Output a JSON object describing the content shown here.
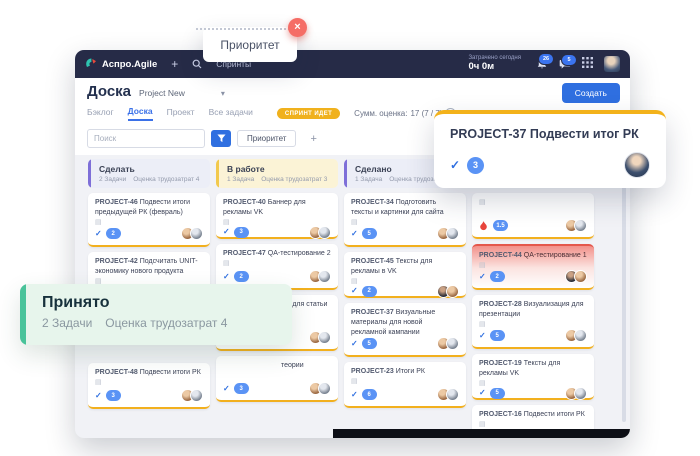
{
  "tooltip": {
    "label": "Приоритет"
  },
  "accepted_overlay": {
    "title": "Принято",
    "tasks": "2 Задачи",
    "effort": "Оценка трудозатрат 4"
  },
  "focus_card": {
    "title": "PROJECT-37 Подвести итог РК",
    "score": "3"
  },
  "navbar": {
    "brand": "Аспро.Agile",
    "nav_item": "Спринты",
    "time_label": "Затрачено сегодня",
    "time_value": "0ч 0м",
    "bell_badge": "26",
    "chat_badge": "5"
  },
  "header": {
    "title": "Доска",
    "project": "Project New",
    "tabs": [
      "Бэклог",
      "Доска",
      "Проект",
      "Все задачи"
    ],
    "sprint_badge": "СПРИНТ ИДЕТ",
    "score_label": "Сумм. оценка:",
    "score_value": "17 (7 / 7)",
    "create_label": "Создать"
  },
  "filters": {
    "search_placeholder": "Поиск",
    "priority_chip": "Приоритет",
    "add_label": "+"
  },
  "board": {
    "columns": [
      {
        "name": "Сделать",
        "tasks": "2 Задачи",
        "effort": "Оценка трудозатрат 4",
        "cards": [
          {
            "id": "PROJECT-46",
            "title": "Подвести итоги предыдущей РК (февраль)",
            "score": "2"
          },
          {
            "id": "PROJECT-42",
            "title": "Подсчитать UNIT-экономику нового продукта",
            "score": "2"
          },
          {
            "id": "PROJECT-48",
            "title": "Подвести итоги РК",
            "score": "3"
          }
        ]
      },
      {
        "name": "В работе",
        "tasks": "1 Задача",
        "effort": "Оценка трудозатрат 3",
        "cards": [
          {
            "id": "PROJECT-40",
            "title": "Баннер для рекламы VK",
            "score": "3"
          },
          {
            "id": "PROJECT-47",
            "title": "QA-тестирование 2",
            "score": "2"
          },
          {
            "id": "PROJECT-38",
            "title": "Тексты для статьи на",
            "score": ""
          },
          {
            "id": "",
            "title": "теории",
            "score": "3"
          }
        ]
      },
      {
        "name": "Сделано",
        "tasks": "1 Задача",
        "effort": "Оценка трудозатрат",
        "cards": [
          {
            "id": "PROJECT-34",
            "title": "Подготовить тексты и картинки для сайта",
            "score": "5"
          },
          {
            "id": "PROJECT-45",
            "title": "Тексты для рекламы в VK",
            "score": "2"
          },
          {
            "id": "PROJECT-37",
            "title": "Визуальные материалы для новой рекламной кампании",
            "score": "5"
          },
          {
            "id": "PROJECT-23",
            "title": "Итоги РК",
            "score": "6"
          }
        ]
      },
      {
        "name": "",
        "tasks": "",
        "effort": "",
        "cards": [
          {
            "id": "",
            "title": "",
            "score": "1.5"
          },
          {
            "id": "PROJECT-44",
            "title": "QA-тестирование 1",
            "score": "2"
          },
          {
            "id": "PROJECT-28",
            "title": "Визуализация для презентации",
            "score": "5"
          },
          {
            "id": "PROJECT-19",
            "title": "Тексты для рекламы VK",
            "score": "5"
          },
          {
            "id": "PROJECT-16",
            "title": "Подвести итоги РК",
            "score": ""
          }
        ]
      }
    ]
  },
  "colors": {
    "accent_blue": "#3b71e8",
    "accent_yellow": "#f2b01e",
    "navbar_bg": "#262b47",
    "mint_bg": "#e7f5ec",
    "mint_accent": "#49c39a",
    "danger": "#f05a4f"
  }
}
